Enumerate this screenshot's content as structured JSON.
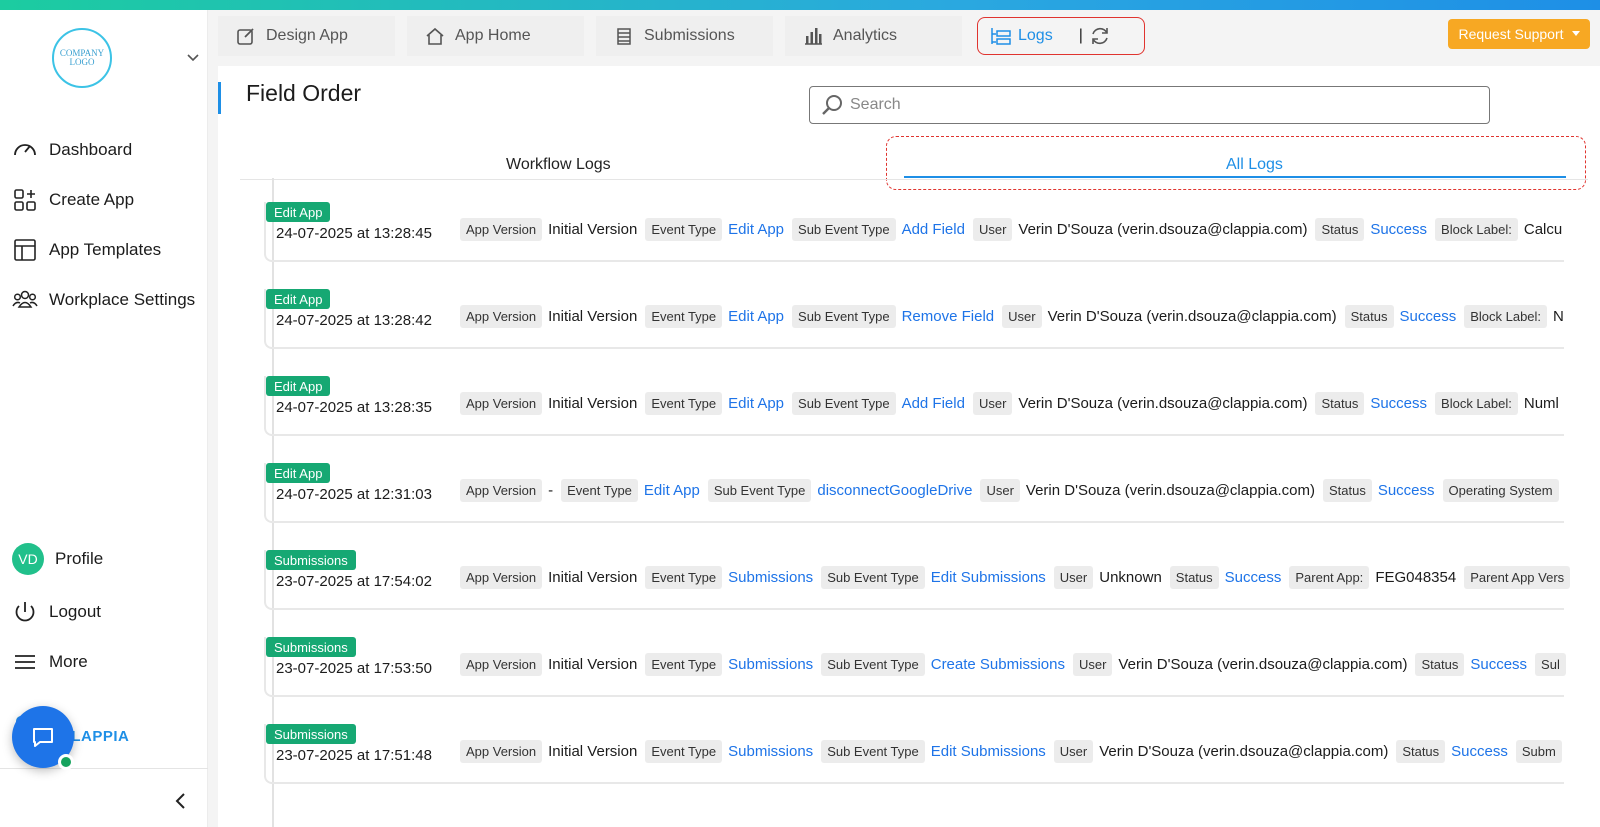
{
  "sidebar": {
    "logo_text": "COMPANY LOGO",
    "nav": [
      {
        "label": "Dashboard",
        "icon": "gauge-icon"
      },
      {
        "label": "Create App",
        "icon": "create-app-icon"
      },
      {
        "label": "App Templates",
        "icon": "templates-icon"
      },
      {
        "label": "Workplace Settings",
        "icon": "users-icon"
      }
    ],
    "profile": {
      "initials": "VD",
      "label": "Profile"
    },
    "logout": "Logout",
    "more": "More",
    "brand": "CLAPPIA"
  },
  "tabs": {
    "design": "Design App",
    "home": "App Home",
    "submissions": "Submissions",
    "analytics": "Analytics",
    "logs": "Logs",
    "separator": "|"
  },
  "request_support": "Request Support",
  "page": {
    "title": "Field Order",
    "search_placeholder": "Search"
  },
  "subtabs": {
    "workflow": "Workflow Logs",
    "all": "All Logs"
  },
  "labels": {
    "app_version": "App Version",
    "event_type": "Event Type",
    "sub_event_type": "Sub Event Type",
    "user": "User",
    "status": "Status"
  },
  "logs": [
    {
      "badge": "Edit App",
      "time": "24-07-2025 at 13:28:45",
      "version": "Initial Version",
      "event": "Edit App",
      "sub_event": "Add Field",
      "user": "Verin D'Souza (verin.dsouza@clappia.com)",
      "status": "Success",
      "extra_label": "Block Label:",
      "extra_value": "Calcu"
    },
    {
      "badge": "Edit App",
      "time": "24-07-2025 at 13:28:42",
      "version": "Initial Version",
      "event": "Edit App",
      "sub_event": "Remove Field",
      "user": "Verin D'Souza (verin.dsouza@clappia.com)",
      "status": "Success",
      "extra_label": "Block Label:",
      "extra_value": "N"
    },
    {
      "badge": "Edit App",
      "time": "24-07-2025 at 13:28:35",
      "version": "Initial Version",
      "event": "Edit App",
      "sub_event": "Add Field",
      "user": "Verin D'Souza (verin.dsouza@clappia.com)",
      "status": "Success",
      "extra_label": "Block Label:",
      "extra_value": "Numl"
    },
    {
      "badge": "Edit App",
      "time": "24-07-2025 at 12:31:03",
      "version": "-",
      "event": "Edit App",
      "sub_event": "disconnectGoogleDrive",
      "user": "Verin D'Souza (verin.dsouza@clappia.com)",
      "status": "Success",
      "extra_label": "Operating System",
      "extra_value": ""
    },
    {
      "badge": "Submissions",
      "time": "23-07-2025 at 17:54:02",
      "version": "Initial Version",
      "event": "Submissions",
      "sub_event": "Edit Submissions",
      "user": "Unknown",
      "status": "Success",
      "extra_label": "Parent App:",
      "extra_value": "FEG048354",
      "extra_label2": "Parent App Vers"
    },
    {
      "badge": "Submissions",
      "time": "23-07-2025 at 17:53:50",
      "version": "Initial Version",
      "event": "Submissions",
      "sub_event": "Create Submissions",
      "user": "Verin D'Souza (verin.dsouza@clappia.com)",
      "status": "Success",
      "extra_label": "Sul",
      "extra_value": ""
    },
    {
      "badge": "Submissions",
      "time": "23-07-2025 at 17:51:48",
      "version": "Initial Version",
      "event": "Submissions",
      "sub_event": "Edit Submissions",
      "user": "Verin D'Souza (verin.dsouza@clappia.com)",
      "status": "Success",
      "extra_label": "Subm",
      "extra_value": ""
    }
  ],
  "colors": {
    "accent": "#1e8fe6",
    "badge": "#16a873",
    "support": "#f7a823",
    "highlight": "#e0342f"
  }
}
